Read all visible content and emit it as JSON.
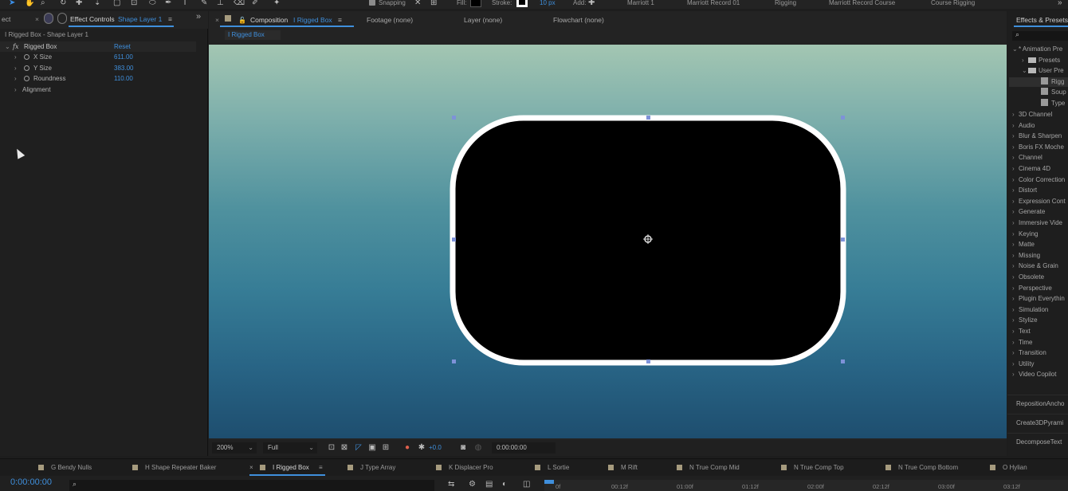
{
  "toolbar": {
    "snapping_label": "Snapping",
    "fill_label": "Fill:",
    "stroke_label": "Stroke:",
    "stroke_width": "10 px",
    "add_label": "Add:",
    "workspaces": [
      "Marriott 1",
      "Marriott Record 01",
      "Rigging",
      "Marriott Record Course",
      "Course Rigging"
    ],
    "fill_color": "#000000",
    "stroke_color": "#ffffff"
  },
  "left_panel": {
    "project_tab": "ect",
    "effect_controls_label": "Effect Controls",
    "effect_controls_layer": "Shape Layer 1",
    "menu_icon": "≡",
    "expand_icon": "»",
    "subtitle": "I Rigged Box - Shape Layer 1",
    "effect": {
      "fx_label": "fx",
      "name": "Rigged Box",
      "reset_label": "Reset",
      "properties": [
        {
          "name": "X Size",
          "value": "611.00"
        },
        {
          "name": "Y Size",
          "value": "383.00"
        },
        {
          "name": "Roundness",
          "value": "110.00"
        }
      ],
      "group": "Alignment"
    }
  },
  "comp_panel": {
    "composition_label": "Composition",
    "composition_name": "I Rigged Box",
    "footage_tab": "Footage (none)",
    "layer_tab": "Layer (none)",
    "flowchart_tab": "Flowchart (none)",
    "breadcrumb": "I Rigged Box",
    "background_top_color": "#a3c6b2",
    "background_bottom_color": "#1e4e6f",
    "viewer_bar": {
      "zoom": "200%",
      "resolution": "Full",
      "exposure": "+0.0",
      "timecode": "0:00:00:00"
    }
  },
  "effects_presets": {
    "title": "Effects & Presets",
    "tree": [
      {
        "label": "* Animation Pre",
        "level": 0,
        "open": true
      },
      {
        "label": "Presets",
        "level": 1,
        "folder": true
      },
      {
        "label": "User Pre",
        "level": 1,
        "folder": true,
        "open": true
      },
      {
        "label": "Rigg",
        "level": 2,
        "preset": true,
        "selected": true
      },
      {
        "label": "Soup",
        "level": 2,
        "preset": true
      },
      {
        "label": "Type",
        "level": 2,
        "preset": true
      }
    ],
    "categories": [
      "3D Channel",
      "Audio",
      "Blur & Sharpen",
      "Boris FX Moche",
      "Channel",
      "Cinema 4D",
      "Color Correction",
      "Distort",
      "Expression Cont",
      "Generate",
      "Immersive Vide",
      "Keying",
      "Matte",
      "Missing",
      "Noise & Grain",
      "Obsolete",
      "Perspective",
      "Plugin Everythin",
      "Simulation",
      "Stylize",
      "Text",
      "Time",
      "Transition",
      "Utility",
      "Video Copilot"
    ],
    "extra_panels": [
      "RepositionAncho",
      "Create3DPyrami",
      "DecomposeText"
    ]
  },
  "timeline": {
    "tabs": [
      "G Bendy Nulls",
      "H Shape Repeater Baker",
      "I Rigged Box",
      "J Type Array",
      "K Displacer Pro",
      "L Sortie",
      "M Rift",
      "N True Comp Mid",
      "N True Comp Top",
      "N True Comp Bottom",
      "O Hylian"
    ],
    "active_tab": "I Rigged Box",
    "timecode": "0:00:00:00",
    "ruler_labels": [
      "0f",
      "00:12f",
      "01:00f",
      "01:12f",
      "02:00f",
      "02:12f",
      "03:00f",
      "03:12f"
    ]
  }
}
